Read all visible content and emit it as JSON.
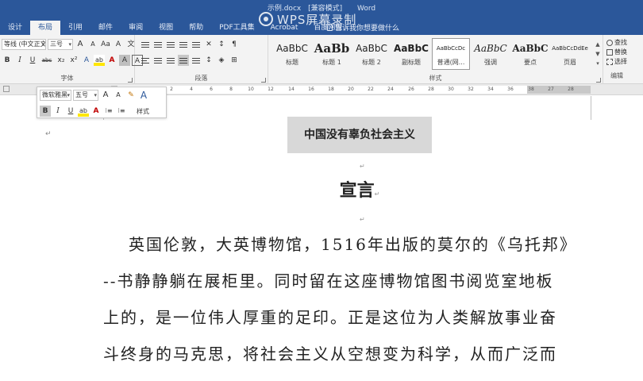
{
  "title_bar": {
    "doc_name": "示例.docx",
    "mode": "[兼容模式]",
    "app": "Word",
    "watermark": "WPS屏幕录制"
  },
  "tabs": [
    "设计",
    "布局",
    "引用",
    "邮件",
    "审阅",
    "视图",
    "帮助",
    "PDF工具集",
    "Acrobat",
    "百度网盘"
  ],
  "tell_me": "告诉我你想要做什么",
  "ribbon": {
    "font": {
      "name": "等线 (中文正文)",
      "size": "三号",
      "grow": "A",
      "shrink": "A",
      "case": "Aa",
      "clear": "A",
      "wen": "文",
      "phonetic": "A",
      "bold": "B",
      "italic": "I",
      "underline": "U",
      "strike": "abc",
      "sub": "x₂",
      "sup": "x²",
      "effects": "A",
      "highlight": "ab",
      "color": "A",
      "char_shade": "A",
      "char_border": "A",
      "label": "字体"
    },
    "paragraph": {
      "label": "段落"
    },
    "styles": {
      "label": "样式",
      "items": [
        {
          "preview": "AaBbC",
          "name": "标题"
        },
        {
          "preview": "AaBb",
          "name": "标题 1"
        },
        {
          "preview": "AaBbC",
          "name": "标题 2"
        },
        {
          "preview": "AaBbC",
          "name": "副标题"
        },
        {
          "preview": "AaBbCcDc",
          "name": "普通(网..."
        },
        {
          "preview": "AaBbC",
          "name": "强调"
        },
        {
          "preview": "AaBbC",
          "name": "要点"
        },
        {
          "preview": "AaBbCcDdEe",
          "name": "页眉"
        }
      ]
    },
    "editing": {
      "label": "编辑",
      "find": "查找",
      "replace": "替换",
      "select": "选择"
    }
  },
  "ruler_ticks": [
    "4",
    "2",
    "2",
    "4",
    "6",
    "8",
    "10",
    "12",
    "14",
    "16",
    "18",
    "20",
    "22",
    "24",
    "26",
    "28",
    "30",
    "32",
    "34",
    "36",
    "38",
    "27",
    "28"
  ],
  "mini_toolbar": {
    "font": "微软雅黑",
    "size": "五号",
    "grow": "A",
    "shrink": "A",
    "brush": "✎",
    "styles_icon": "A",
    "bold": "B",
    "italic": "I",
    "underline": "U",
    "highlight": "ab",
    "color": "A",
    "list1": "⁝≡",
    "list2": "⁝≡",
    "style_label": "样式"
  },
  "document": {
    "heading": "中国没有辜负社会主义",
    "para_mark": "↵",
    "subtitle": "宣言",
    "body_lines": [
      "英国伦敦，大英博物馆，1516年出版的莫尔的《乌托邦》",
      "--书静静躺在展柜里。同时留在这座博物馆图书阅览室地板",
      "上的，是一位伟人厚重的足印。正是这位为人类解放事业奋",
      "斗终身的马克思，将社会主义从空想变为科学，从而广泛而"
    ]
  },
  "colors": {
    "title_bar": "#2b579a",
    "ribbon": "#f3f3f3",
    "heading_highlight": "#d8d8d8"
  }
}
